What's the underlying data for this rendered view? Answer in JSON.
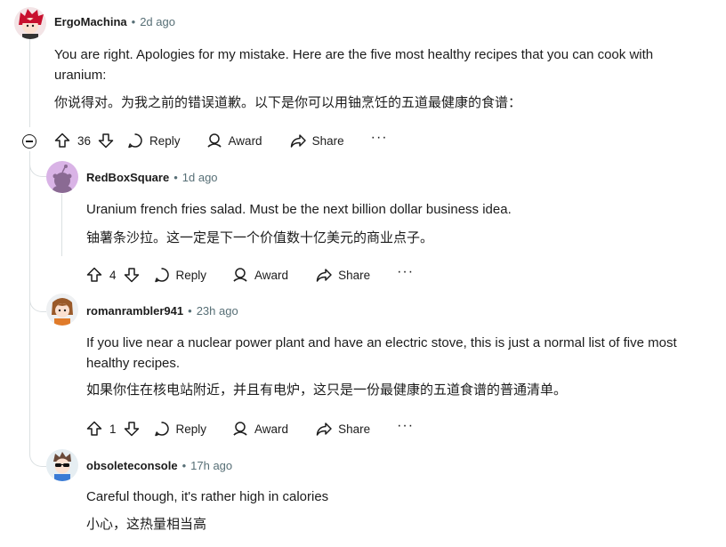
{
  "actions": {
    "reply": "Reply",
    "award": "Award",
    "share": "Share",
    "more": "···"
  },
  "comments": [
    {
      "author": "ErgoMachina",
      "time": "2d ago",
      "text_en": "You are right. Apologies for my mistake. Here are the five most healthy recipes that you can cook with uranium:",
      "text_zh": "你说得对。为我之前的错误道歉。以下是你可以用铀烹饪的五道最健康的食谱：",
      "votes": "36",
      "avatar_icon": "red-hair-avatar-icon"
    },
    {
      "author": "RedBoxSquare",
      "time": "1d ago",
      "text_en": "Uranium french fries salad. Must be the next billion dollar business idea.",
      "text_zh": "铀薯条沙拉。这一定是下一个价值数十亿美元的商业点子。",
      "votes": "4",
      "avatar_icon": "snoo-avatar-icon"
    },
    {
      "author": "romanrambler941",
      "time": "23h ago",
      "text_en": "If you live near a nuclear power plant and have an electric stove, this is just a normal list of five most healthy recipes.",
      "text_zh": "如果你住在核电站附近，并且有电炉，这只是一份最健康的五道食谱的普通清单。",
      "votes": "1",
      "avatar_icon": "brown-hair-avatar-icon"
    },
    {
      "author": "obsoleteconsole",
      "time": "17h ago",
      "text_en": "Careful though, it's rather high in calories",
      "text_zh": "小心，这热量相当高",
      "avatar_icon": "sunglasses-avatar-icon"
    }
  ]
}
